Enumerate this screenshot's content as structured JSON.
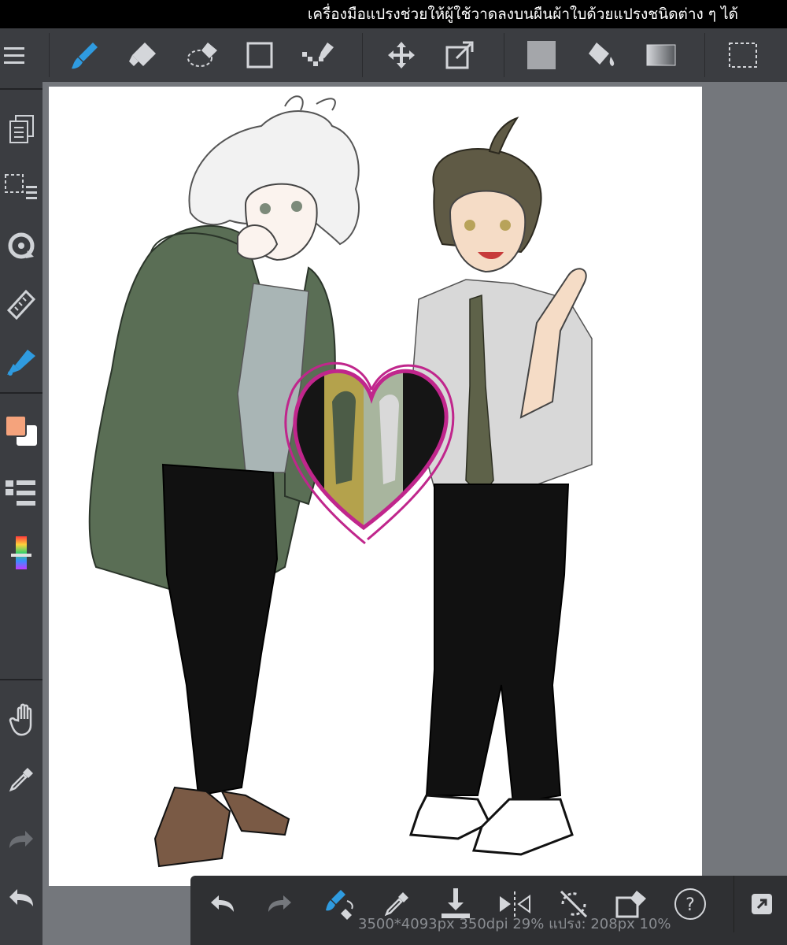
{
  "hint_text": "เครื่องมือแปรงช่วยให้ผู้ใช้วาดลงบนผืนผ้าใบด้วยแปรงชนิดต่าง ๆ ได้",
  "status_text": "3500*4093px 350dpi 29% แปรง: 208px 10%",
  "toolbar": {
    "tools": [
      "menu-icon",
      "brush-icon",
      "eraser-icon",
      "selection-eraser-icon",
      "rectangle-icon",
      "dot-pen-icon",
      "move-icon",
      "transform-icon",
      "fill-color-icon",
      "bucket-icon",
      "gradient-icon",
      "select-icon"
    ]
  },
  "sidebar": {
    "tools": [
      "layers-icon",
      "selection-layer-icon",
      "rotate-icon",
      "ruler-icon",
      "brush-active-icon",
      "color-swatch",
      "layer-list-icon",
      "color-slider-icon",
      "hand-icon",
      "eyedropper-icon",
      "redo-icon",
      "undo-icon"
    ]
  },
  "bottom_bar": {
    "tools": [
      "undo-icon",
      "redo-icon",
      "brush-switch-icon",
      "eyedropper-icon",
      "download-icon",
      "flip-icon",
      "rotate-off-icon",
      "transform-eraser-icon",
      "help-icon",
      "external-link-icon"
    ]
  },
  "colors": {
    "accent": "#2f9be0",
    "primary_color": "#f5a37c",
    "secondary_color": "#ffffff",
    "heart": "#c0268c"
  }
}
